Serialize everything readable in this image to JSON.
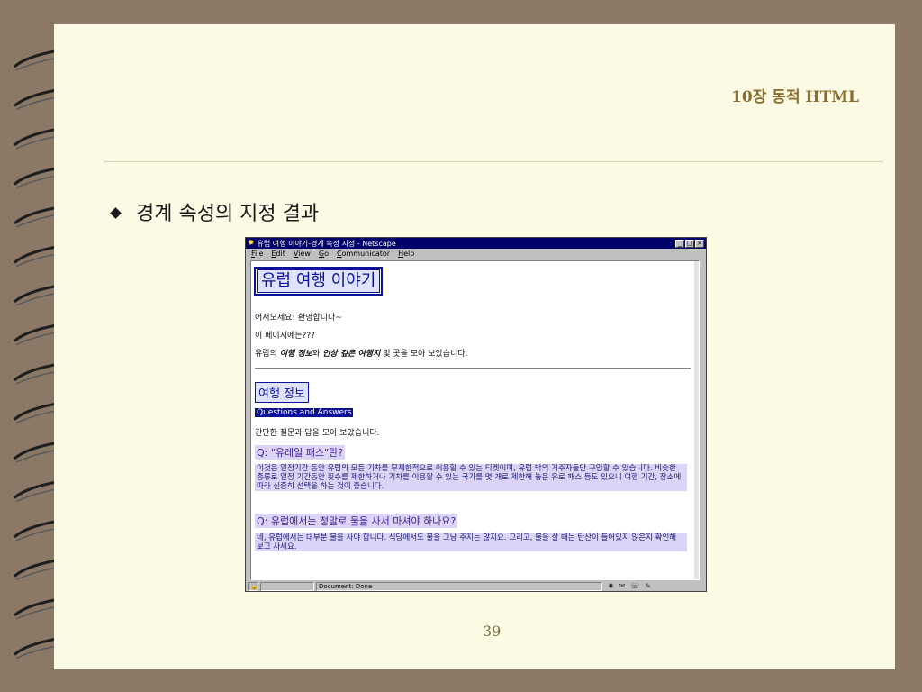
{
  "slide": {
    "title": "10장  동적 HTML",
    "bullet": "경계 속성의 지정 결과",
    "page_number": "39"
  },
  "browser": {
    "title": "유럽 여행 이야기-경계 속성 지정 - Netscape",
    "window_buttons": [
      "_",
      "□",
      "×"
    ],
    "menu": [
      "File",
      "Edit",
      "View",
      "Go",
      "Communicator",
      "Help"
    ],
    "status": "Document: Done"
  },
  "page": {
    "h1": "유럽 여행 이야기",
    "welcome": "어서오세요! 환영합니다~",
    "question_line": "이 페이지에는???",
    "intro_prefix": "유럽의 ",
    "intro_travel_info": "여행 정보",
    "intro_and": "와 ",
    "intro_impressive": "인상 깊은 여행지",
    "intro_suffix": " 및 곳을 모아 보았습니다.",
    "h2": "여행 정보",
    "qa_heading": "Questions and Answers",
    "qa_desc": "간단한 질문과 답을 모아 보았습니다.",
    "q1": "Q: \"유레일 패스\"란?",
    "a1": "이것은 일정기간 동안 유럽의 모든 기차를 무제한적으로 이용할 수 있는 티켓이며, 유럽 밖의 거주자들만 구입할 수 있습니다. 비슷한 종류로 일정 기간동안 횟수를 제한하거나 기차를 이용할 수 있는 국가를 몇 개로 제한해 놓은 유로 패스 등도 있으니 여행 기간, 장소에 따라 신중히 선택을 하는 것이 좋습니다.",
    "q2": "Q: 유럽에서는 정말로 물을 사서 마셔야 하나요?",
    "a2": "네, 유럽에서는 대부분 물을 사야 합니다. 식당에서도 물을 그냥 주지는 않지요. 그리고, 물을 살 때는 탄산이 들어있지 않은지 확인해 보고 사세요."
  },
  "colors": {
    "background": "#8b7866",
    "slide_bg": "#fbfbe5",
    "title_color": "#8b6e2f",
    "titlebar": "#00006a",
    "heading_blue": "#0a1396",
    "qa_highlight": "#dcd4f7"
  },
  "icons": [
    "spiral-binding-icon",
    "netscape-icon",
    "lock-icon",
    "mail-icon",
    "composer-icon"
  ]
}
